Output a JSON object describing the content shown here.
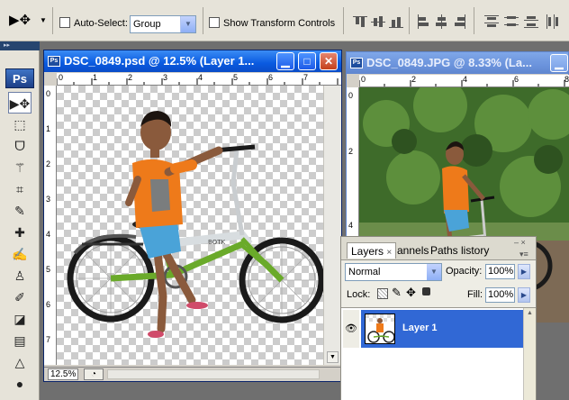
{
  "options_bar": {
    "auto_select_label": "Auto-Select:",
    "auto_select_value": "Group",
    "show_transform_label": "Show Transform Controls"
  },
  "toolbox": {
    "logo": "Ps"
  },
  "doc1": {
    "title": "DSC_0849.psd @ 12.5% (Layer 1...",
    "zoom": "12.5%",
    "ruler_h": [
      "0",
      "1",
      "2",
      "3",
      "4",
      "5",
      "6",
      "7"
    ],
    "ruler_v": [
      "0",
      "1",
      "2",
      "3",
      "4",
      "5",
      "6",
      "7"
    ]
  },
  "doc2": {
    "title": "DSC_0849.JPG @ 8.33% (La...",
    "ruler_h": [
      "0",
      "2",
      "4",
      "6",
      "8"
    ],
    "ruler_v": [
      "0",
      "2",
      "4"
    ]
  },
  "layers_panel": {
    "tabs": [
      "Layers",
      "annels",
      "Paths",
      "listory"
    ],
    "blend_mode": "Normal",
    "opacity_label": "Opacity:",
    "opacity_value": "100%",
    "lock_label": "Lock:",
    "fill_label": "Fill:",
    "fill_value": "100%",
    "layers": [
      {
        "name": "Layer 1",
        "visible": true,
        "selected": true
      }
    ]
  },
  "colors": {
    "selection": "#3168d5",
    "titlebar": "#0a5ae0"
  }
}
